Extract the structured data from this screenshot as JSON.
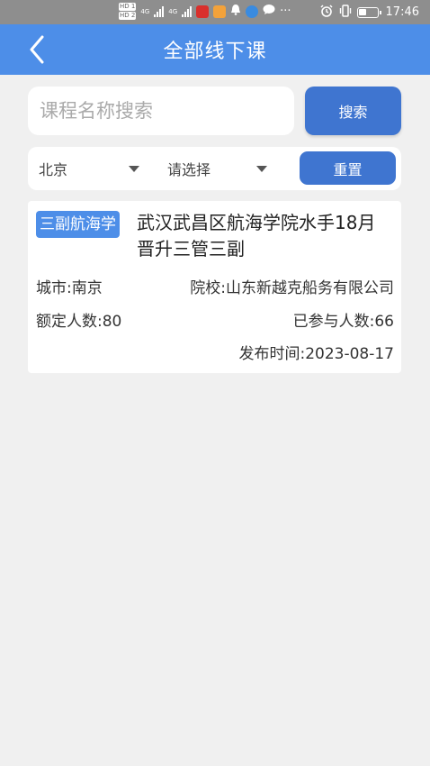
{
  "status_bar": {
    "hd1": "HD 1",
    "hd2": "HD 2",
    "net1": "4G",
    "net2": "4G",
    "ellipsis": "···",
    "time": "17:46"
  },
  "header": {
    "title": "全部线下课"
  },
  "search": {
    "placeholder": "课程名称搜索",
    "value": "",
    "button_label": "搜索"
  },
  "filters": {
    "city": "北京",
    "school_placeholder": "请选择",
    "reset_label": "重置"
  },
  "courses": [
    {
      "tag": "三副航海学",
      "title": "武汉武昌区航海学院水手18月晋升三管三副",
      "city_label": "城市:南京",
      "school_label": "院校:山东新越克船务有限公司",
      "quota_label": "额定人数:80",
      "joined_label": "已参与人数:66",
      "publish_label": "发布时间:2023-08-17"
    }
  ],
  "colors": {
    "primary": "#4d8ee8",
    "button": "#3f75d0",
    "background": "#f0f0f0"
  }
}
